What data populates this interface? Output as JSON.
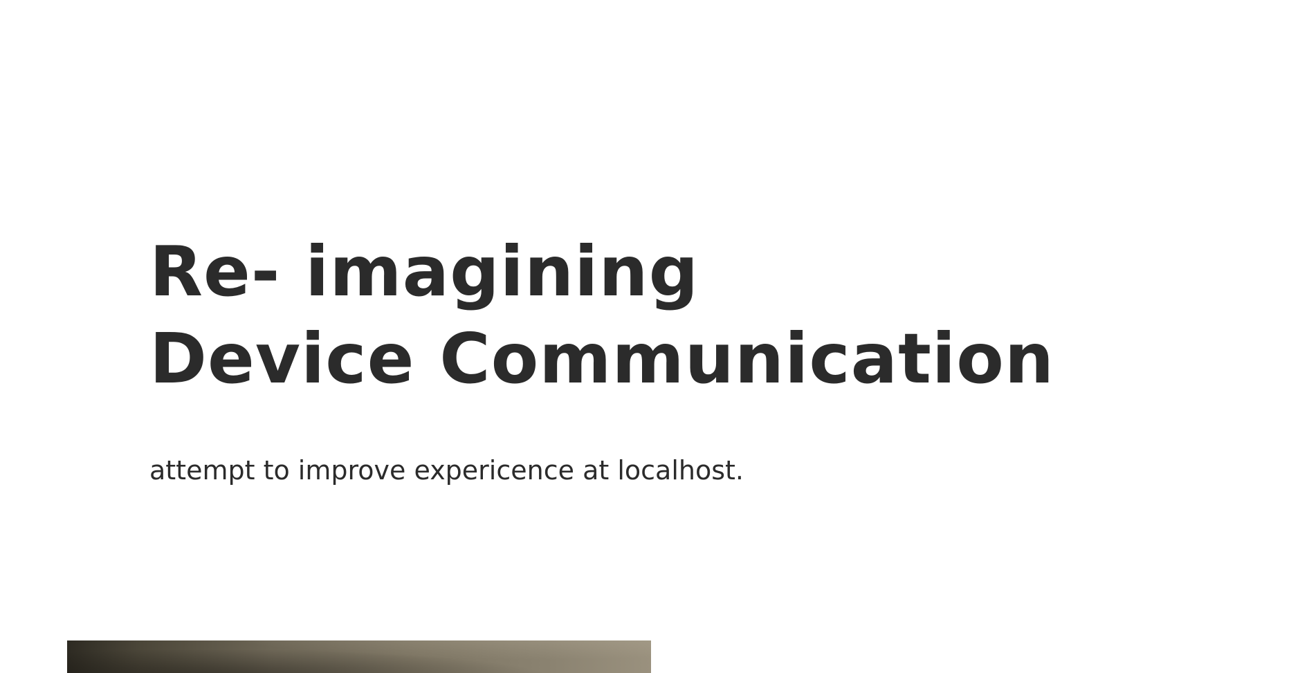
{
  "hero": {
    "title_line1": "Re- imagining",
    "title_line2": "Device Communication",
    "subtitle": "attempt to improve expericence at localhost."
  }
}
